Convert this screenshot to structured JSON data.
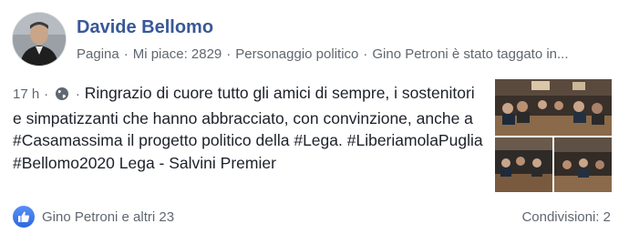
{
  "post": {
    "author": "Davide Bellomo",
    "meta": {
      "type": "Pagina",
      "likes": "Mi piace: 2829",
      "category": "Personaggio politico",
      "tagged": "Gino Petroni è stato taggato in..."
    },
    "time": "17 h",
    "privacy_icon": "globe-icon",
    "text": "Ringrazio di cuore tutto gli amici di sempre, i sostenitori e simpatizzanti che hanno abbracciato, con convinzione, anche a #Casamassima il progetto politico della #Lega. #LiberiamolaPuglia #Bellomo2020 Lega - Salvini Premier"
  },
  "reactions": {
    "icon": "thumbs-up-icon",
    "text": "Gino Petroni e altri 23"
  },
  "shares": "Condivisioni: 2",
  "colors": {
    "author_name": "#385898",
    "secondary_text": "#606770",
    "like_blue": "#2d68e0"
  }
}
